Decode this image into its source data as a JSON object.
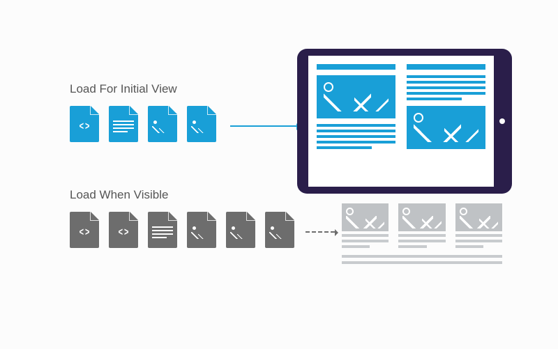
{
  "labels": {
    "initial": "Load For Initial View",
    "visible": "Load When Visible"
  },
  "initial_files": [
    "code",
    "text",
    "image",
    "image"
  ],
  "visible_files": [
    "code",
    "code",
    "text",
    "image",
    "image",
    "image"
  ],
  "colors": {
    "active": "#199fd7",
    "lazy": "#6d6d6d",
    "device_frame": "#2a1e4a",
    "placeholder": "#bfc2c5"
  }
}
